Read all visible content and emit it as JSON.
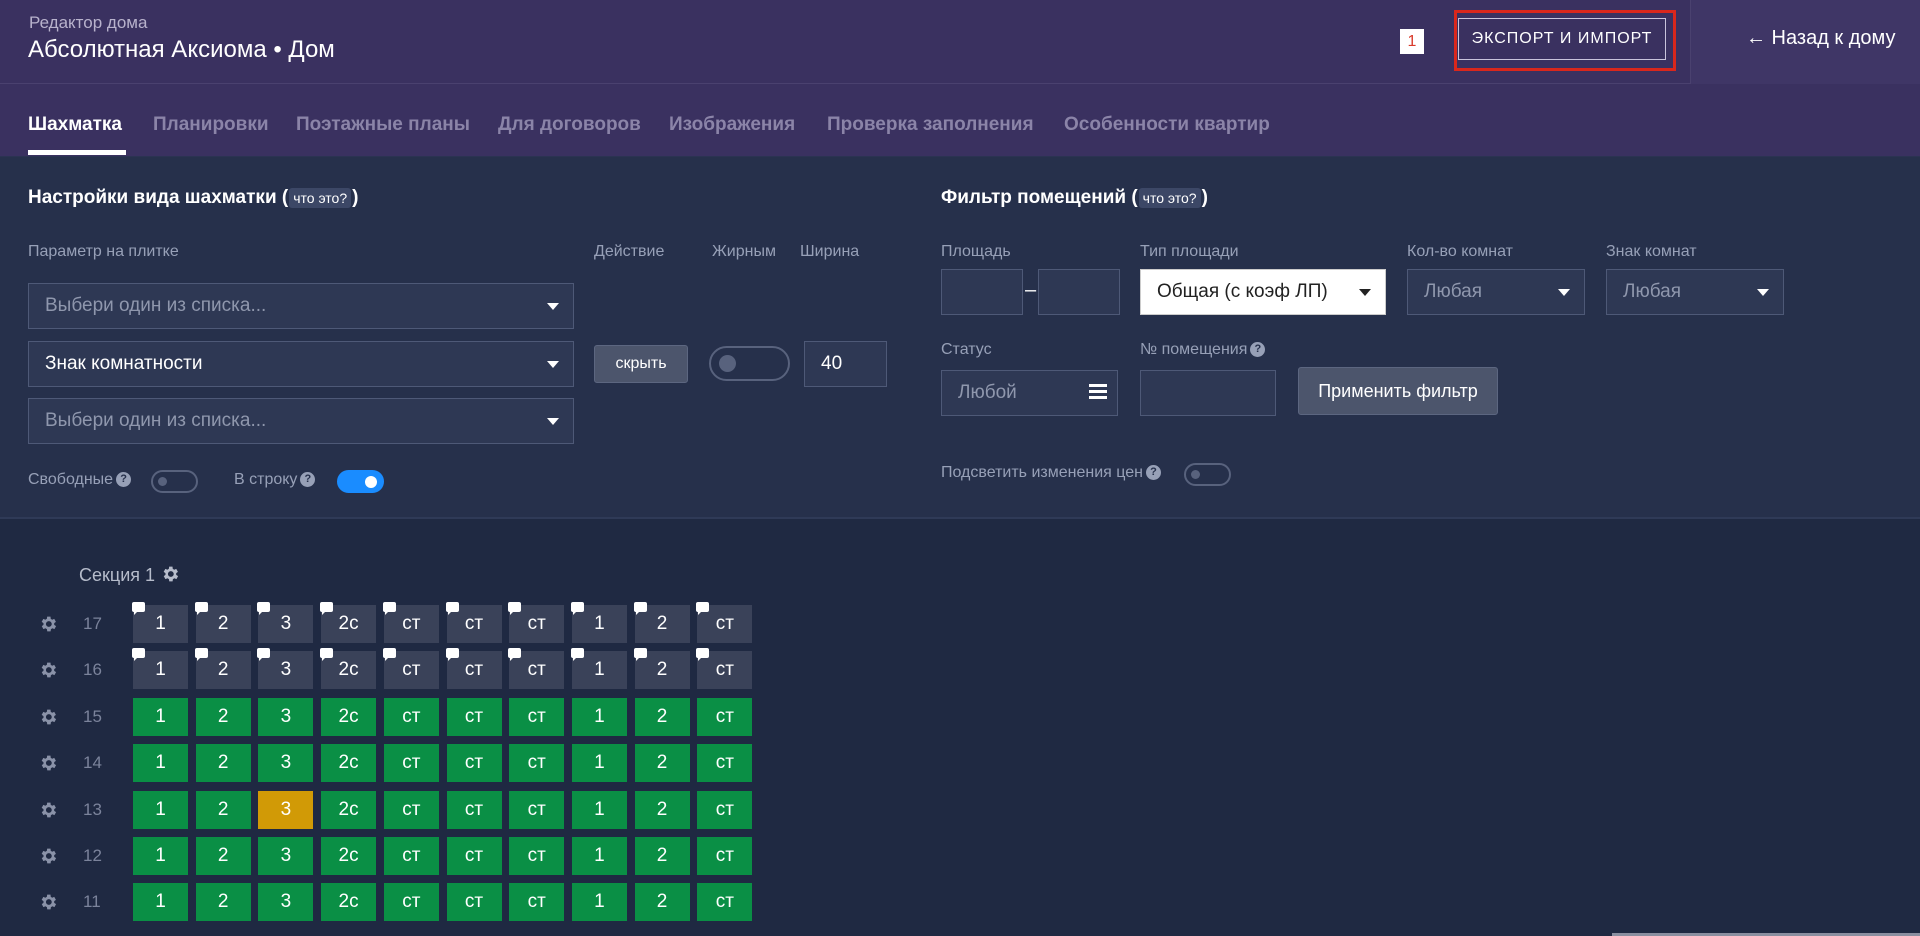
{
  "header": {
    "subtitle": "Редактор дома",
    "title": "Абсолютная Аксиома • Дом",
    "badge": "1",
    "export_label": "ЭКСПОРТ И ИМПОРТ",
    "back_label": "← Назад к дому"
  },
  "tabs": [
    {
      "label": "Шахматка",
      "active": true
    },
    {
      "label": "Планировки",
      "active": false
    },
    {
      "label": "Поэтажные планы",
      "active": false
    },
    {
      "label": "Для договоров",
      "active": false
    },
    {
      "label": "Изображения",
      "active": false
    },
    {
      "label": "Проверка заполнения",
      "active": false
    },
    {
      "label": "Особенности квартир",
      "active": false
    }
  ],
  "view_settings": {
    "title": "Настройки вида шахматки",
    "whatis": "что это?",
    "param_label": "Параметр на плитке",
    "action_label": "Действие",
    "bold_label": "Жирным",
    "width_label": "Ширина",
    "select1_placeholder": "Выбери один из списка...",
    "select2_value": "Знак комнатности",
    "select3_placeholder": "Выбери один из списка...",
    "hide_button": "скрыть",
    "bold_toggle_on": false,
    "width_value": "40",
    "free_label": "Свободные",
    "free_toggle_on": false,
    "inline_label": "В строку",
    "inline_toggle_on": true
  },
  "filter": {
    "title": "Фильтр помещений",
    "whatis": "что это?",
    "area_label": "Площадь",
    "area_from": "",
    "area_to": "",
    "dash": "–",
    "area_type_label": "Тип площади",
    "area_type_value": "Общая (с коэф ЛП)",
    "rooms_label": "Кол-во комнат",
    "rooms_value": "Любая",
    "rooms_sign_label": "Знак комнат",
    "rooms_sign_value": "Любая",
    "status_label": "Статус",
    "status_value": "Любой",
    "number_label": "№ помещения",
    "number_value": "",
    "apply_button": "Применить фильтр",
    "highlight_label": "Подсветить изменения цен",
    "highlight_toggle_on": false
  },
  "grid": {
    "section_label": "Секция 1",
    "columns": [
      "1",
      "2",
      "3",
      "2с",
      "ст",
      "ст",
      "ст",
      "1",
      "2",
      "ст"
    ],
    "floors": [
      {
        "num": "17",
        "status": [
          "empty",
          "empty",
          "empty",
          "empty",
          "empty",
          "empty",
          "empty",
          "empty",
          "empty",
          "empty"
        ],
        "comments": true
      },
      {
        "num": "16",
        "status": [
          "empty",
          "empty",
          "empty",
          "empty",
          "empty",
          "empty",
          "empty",
          "empty",
          "empty",
          "empty"
        ],
        "comments": true
      },
      {
        "num": "15",
        "status": [
          "free",
          "free",
          "free",
          "free",
          "free",
          "free",
          "free",
          "free",
          "free",
          "free"
        ],
        "comments": false
      },
      {
        "num": "14",
        "status": [
          "free",
          "free",
          "free",
          "free",
          "free",
          "free",
          "free",
          "free",
          "free",
          "free"
        ],
        "comments": false
      },
      {
        "num": "13",
        "status": [
          "free",
          "free",
          "booked",
          "free",
          "free",
          "free",
          "free",
          "free",
          "free",
          "free"
        ],
        "comments": false
      },
      {
        "num": "12",
        "status": [
          "free",
          "free",
          "free",
          "free",
          "free",
          "free",
          "free",
          "free",
          "free",
          "free"
        ],
        "comments": false
      },
      {
        "num": "11",
        "status": [
          "free",
          "free",
          "free",
          "free",
          "free",
          "free",
          "free",
          "free",
          "free",
          "free"
        ],
        "comments": false
      }
    ]
  },
  "colors": {
    "free": "#0a8f45",
    "booked": "#d19a06",
    "empty": "#3a4259",
    "accent": "#1a8cff",
    "highlight_outline": "#d9271c"
  }
}
